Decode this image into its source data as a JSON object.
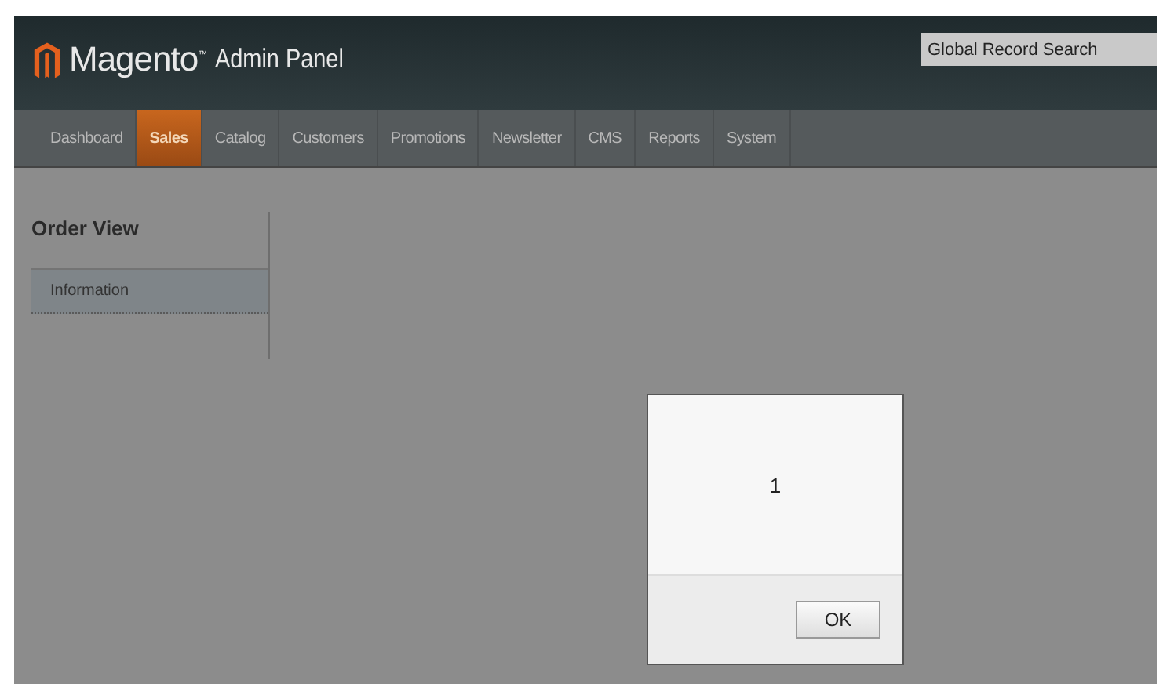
{
  "header": {
    "brand": "Magento$^{™}$",
    "product": "Admin Panel",
    "search": {
      "placeholder": "Global Record Search"
    }
  },
  "nav": [
    {
      "label": "Dashboard",
      "selected": false
    },
    {
      "label": "Sales",
      "selected": true
    },
    {
      "label": "Catalog",
      "selected": false
    },
    {
      "label": "Customers",
      "selected": false
    },
    {
      "label": "Promotions",
      "selected": false
    },
    {
      "label": "Newsletter",
      "selected": false
    },
    {
      "label": "CMS",
      "selected": false
    },
    {
      "label": "Reports",
      "selected": false
    },
    {
      "label": "System",
      "selected": false
    }
  ],
  "sidebar": {
    "title": "Order View",
    "items": [
      {
        "label": "Information",
        "selected": true
      }
    ]
  },
  "dialog": {
    "message": "1",
    "buttons": [
      "OK"
    ]
  }
}
